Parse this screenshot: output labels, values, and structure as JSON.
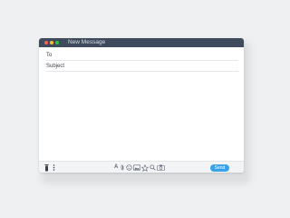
{
  "window": {
    "title": "New Message"
  },
  "fields": {
    "to_label": "To",
    "subject_label": "Subject"
  },
  "toolbar": {
    "format_text": "A",
    "send_label": "Send"
  },
  "colors": {
    "titlebar": "#3f4b5c",
    "close": "#ff5f56",
    "minimize": "#ffbd2e",
    "maximize": "#27c93f",
    "send": "#3aa3e8"
  },
  "icons": [
    "trash-icon",
    "more-options-icon",
    "format-text-icon",
    "attach-icon",
    "emoji-icon",
    "insert-image-icon",
    "star-icon",
    "search-icon",
    "camera-icon"
  ]
}
